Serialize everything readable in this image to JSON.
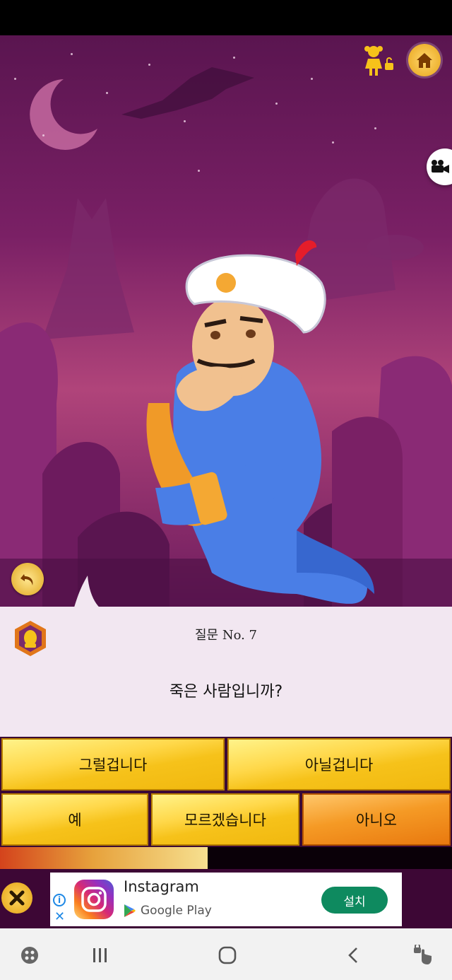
{
  "question": {
    "number_label": "질문 No. 7",
    "text": "죽은 사람입니까?"
  },
  "answers": [
    {
      "label": "그럴겁니다",
      "selected": false
    },
    {
      "label": "아닐겁니다",
      "selected": false
    },
    {
      "label": "예",
      "selected": false
    },
    {
      "label": "모르겠습니다",
      "selected": false
    },
    {
      "label": "아니오",
      "selected": true
    }
  ],
  "progress": {
    "fraction": 0.46
  },
  "ad": {
    "app_name": "Instagram",
    "store_name": "Google Play",
    "install_label": "설치",
    "info_icon": "info-icon",
    "close_icon": "close-icon"
  },
  "icons": {
    "home": "home-icon",
    "child_mode": "child-lock-icon",
    "video": "video-camera-icon",
    "undo": "undo-icon",
    "close_ad": "close-icon",
    "badge": "profile-badge-icon"
  },
  "colors": {
    "background_purple": "#7a2065",
    "panel": "#f2e7f1",
    "answer_yellow": "#f6c21a",
    "answer_selected": "#e9790f",
    "install_green": "#0e8a5f"
  },
  "navbar": {
    "items": [
      "game-launcher-icon",
      "recent-apps-icon",
      "home-circle-icon",
      "back-icon",
      "touch-lock-icon"
    ]
  }
}
